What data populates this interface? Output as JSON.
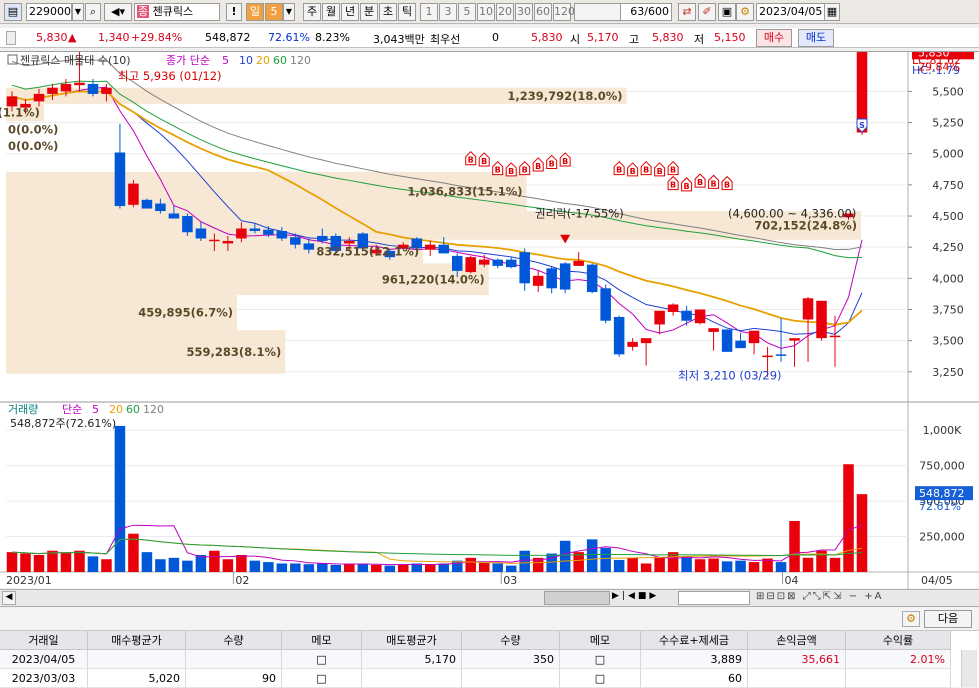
{
  "toolbar": {
    "code": "229000",
    "name_prefix": "종",
    "name": "젠큐릭스",
    "period_unit": "일",
    "period_value": "5",
    "periods": [
      "주",
      "월",
      "년",
      "분",
      "초",
      "틱"
    ],
    "intervals": [
      "1",
      "3",
      "5",
      "10",
      "20",
      "30",
      "60",
      "120"
    ],
    "count": "63",
    "count_max": "/600",
    "date": "2023/04/05"
  },
  "quote": {
    "price": "5,830",
    "change": "1,340",
    "change_pct": "+29.84%",
    "volume": "548,872",
    "volume_ratio": "72.61%",
    "turnover_pct": "8.23%",
    "amount": "3,043백만",
    "broker_label": "최우선",
    "broker_value": "0",
    "broker_price": "5,830",
    "open_label": "시",
    "open": "5,170",
    "high_label": "고",
    "high": "5,830",
    "low_label": "저",
    "low": "5,150",
    "buy_button": "매수",
    "sell_button": "매도"
  },
  "price_panel": {
    "legend_name": "젠큐릭스 매물대 수(10)",
    "legend_ma": "종가 단순",
    "legend_periods": [
      "5",
      "10",
      "20",
      "60",
      "120"
    ],
    "high_marker": "최고 5,936 (01/12)",
    "low_marker": "최저 3,210 (03/29)",
    "rights_marker": "권리락(-17.55%)",
    "range_label": "(4,600.00 ~ 4,336.00)",
    "lc_label": "LC:81.62",
    "hc_label": "HC:-1.79",
    "last_price": "5,830",
    "last_pct": "29.84%",
    "signal_b": "B",
    "signal_s": "S",
    "y_ticks": [
      "5,500",
      "5,250",
      "5,000",
      "4,750",
      "4,500",
      "4,250",
      "4,000",
      "3,750",
      "3,500",
      "3,250"
    ],
    "volume_profile": [
      {
        "label": "1,239,792(18.0%)",
        "low": 5400,
        "high": 5530
      },
      {
        "label": "78,992(1.1%)",
        "low": 5260,
        "high": 5400
      },
      {
        "label": "0(0.0%)",
        "low": 5130,
        "high": 5260
      },
      {
        "label": "0(0.0%)",
        "low": 4990,
        "high": 5130
      },
      {
        "label": "1,036,833(15.1%)",
        "low": 4540,
        "high": 4855
      },
      {
        "label": "702,152(24.8%)",
        "low": 4310,
        "high": 4540
      },
      {
        "label": "832,515(12.1%)",
        "low": 4120,
        "high": 4310
      },
      {
        "label": "961,220(14.0%)",
        "low": 3865,
        "high": 4120
      },
      {
        "label": "459,895(6.7%)",
        "low": 3585,
        "high": 3865
      },
      {
        "label": "559,283(8.1%)",
        "low": 3235,
        "high": 3585
      }
    ]
  },
  "volume_panel": {
    "legend_name": "거래량",
    "legend_ma": "단순",
    "legend_periods": [
      "5",
      "20",
      "60",
      "120"
    ],
    "current": "548,872주(72.61%)",
    "last_volume": "548,872",
    "last_pct": "72.61%",
    "y_ticks": [
      "1,000K",
      "750,000",
      "500,000",
      "250,000"
    ]
  },
  "x_axis": [
    "2023/01",
    "02",
    "03",
    "04",
    "04/05"
  ],
  "chart_data": {
    "type": "candlestick",
    "candles": [
      [
        5380,
        5500,
        5340,
        5460
      ],
      [
        5370,
        5440,
        5320,
        5400
      ],
      [
        5420,
        5520,
        5380,
        5480
      ],
      [
        5480,
        5560,
        5430,
        5530
      ],
      [
        5500,
        5600,
        5460,
        5560
      ],
      [
        5550,
        5940,
        5500,
        5570
      ],
      [
        5560,
        5600,
        5460,
        5480
      ],
      [
        5480,
        5560,
        5420,
        5530
      ],
      [
        5010,
        5240,
        4560,
        4580
      ],
      [
        4590,
        4790,
        4570,
        4760
      ],
      [
        4630,
        4640,
        4560,
        4560
      ],
      [
        4600,
        4640,
        4520,
        4540
      ],
      [
        4520,
        4580,
        4480,
        4480
      ],
      [
        4500,
        4520,
        4340,
        4370
      ],
      [
        4400,
        4450,
        4300,
        4320
      ],
      [
        4300,
        4360,
        4220,
        4310
      ],
      [
        4280,
        4340,
        4220,
        4300
      ],
      [
        4320,
        4450,
        4290,
        4400
      ],
      [
        4400,
        4440,
        4360,
        4380
      ],
      [
        4390,
        4420,
        4330,
        4350
      ],
      [
        4380,
        4410,
        4300,
        4320
      ],
      [
        4330,
        4360,
        4240,
        4270
      ],
      [
        4280,
        4320,
        4200,
        4230
      ],
      [
        4340,
        4400,
        4280,
        4300
      ],
      [
        4340,
        4360,
        4200,
        4220
      ],
      [
        4280,
        4330,
        4220,
        4300
      ],
      [
        4360,
        4370,
        4220,
        4240
      ],
      [
        4200,
        4270,
        4180,
        4230
      ],
      [
        4220,
        4240,
        4150,
        4170
      ],
      [
        4240,
        4290,
        4230,
        4270
      ],
      [
        4320,
        4330,
        4230,
        4240
      ],
      [
        4230,
        4300,
        4180,
        4270
      ],
      [
        4270,
        4330,
        4200,
        4200
      ],
      [
        4180,
        4200,
        4010,
        4060
      ],
      [
        4050,
        4180,
        4040,
        4170
      ],
      [
        4110,
        4190,
        4090,
        4150
      ],
      [
        4150,
        4160,
        4080,
        4100
      ],
      [
        4150,
        4170,
        4080,
        4090
      ],
      [
        4210,
        4240,
        3900,
        3960
      ],
      [
        3940,
        4060,
        3890,
        4020
      ],
      [
        4080,
        4100,
        3880,
        3920
      ],
      [
        4120,
        4130,
        3880,
        3910
      ],
      [
        4100,
        4210,
        4100,
        4140
      ],
      [
        4110,
        4120,
        3880,
        3890
      ],
      [
        3920,
        3950,
        3640,
        3660
      ],
      [
        3690,
        3700,
        3370,
        3390
      ],
      [
        3450,
        3520,
        3420,
        3490
      ],
      [
        3480,
        3520,
        3300,
        3520
      ],
      [
        3630,
        3650,
        3550,
        3740
      ],
      [
        3730,
        3800,
        3700,
        3790
      ],
      [
        3740,
        3780,
        3620,
        3660
      ],
      [
        3640,
        3740,
        3630,
        3750
      ],
      [
        3570,
        3600,
        3420,
        3600
      ],
      [
        3590,
        3590,
        3430,
        3410
      ],
      [
        3500,
        3560,
        3450,
        3440
      ],
      [
        3480,
        3560,
        3390,
        3580
      ],
      [
        3380,
        3450,
        3210,
        3380
      ],
      [
        3390,
        3680,
        3330,
        3380
      ],
      [
        3500,
        3510,
        3290,
        3520
      ],
      [
        3670,
        3850,
        3330,
        3840
      ],
      [
        3520,
        3530,
        3500,
        3820
      ],
      [
        3540,
        3700,
        3290,
        3540
      ],
      [
        4490,
        4500,
        4470,
        4520
      ],
      [
        5170,
        5830,
        5150,
        5830
      ]
    ]
  }
}
